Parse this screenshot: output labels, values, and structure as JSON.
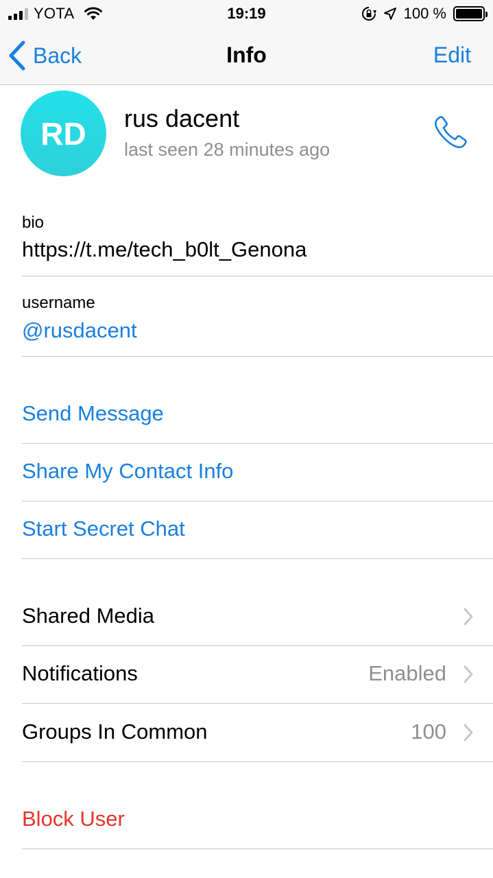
{
  "status_bar": {
    "carrier": "YOTA",
    "time": "19:19",
    "battery": "100 %",
    "signal_bars_filled": 3,
    "signal_bars_total": 4
  },
  "nav": {
    "back_label": "Back",
    "title": "Info",
    "edit_label": "Edit"
  },
  "profile": {
    "initials": "RD",
    "name": "rus dacent",
    "status": "last seen 28 minutes ago"
  },
  "info": {
    "bio_label": "bio",
    "bio_value": "https://t.me/tech_b0lt_Genona",
    "username_label": "username",
    "username_value": "@rusdacent"
  },
  "actions": {
    "send_message": "Send Message",
    "share_contact": "Share My Contact Info",
    "secret_chat": "Start Secret Chat"
  },
  "rows": {
    "shared_media": "Shared Media",
    "notifications": "Notifications",
    "notifications_value": "Enabled",
    "groups_in_common": "Groups In Common",
    "groups_in_common_value": "100"
  },
  "block_user": "Block User",
  "colors": {
    "accent": "#1a7fdf",
    "destructive": "#e5342c",
    "secondary_text": "#8e8e93",
    "avatar": "#2fd6df"
  },
  "icons": [
    "signal-icon",
    "wifi-icon",
    "orientation-lock-icon",
    "location-arrow-icon",
    "battery-icon",
    "chevron-left-icon",
    "phone-icon",
    "chevron-right-icon"
  ]
}
